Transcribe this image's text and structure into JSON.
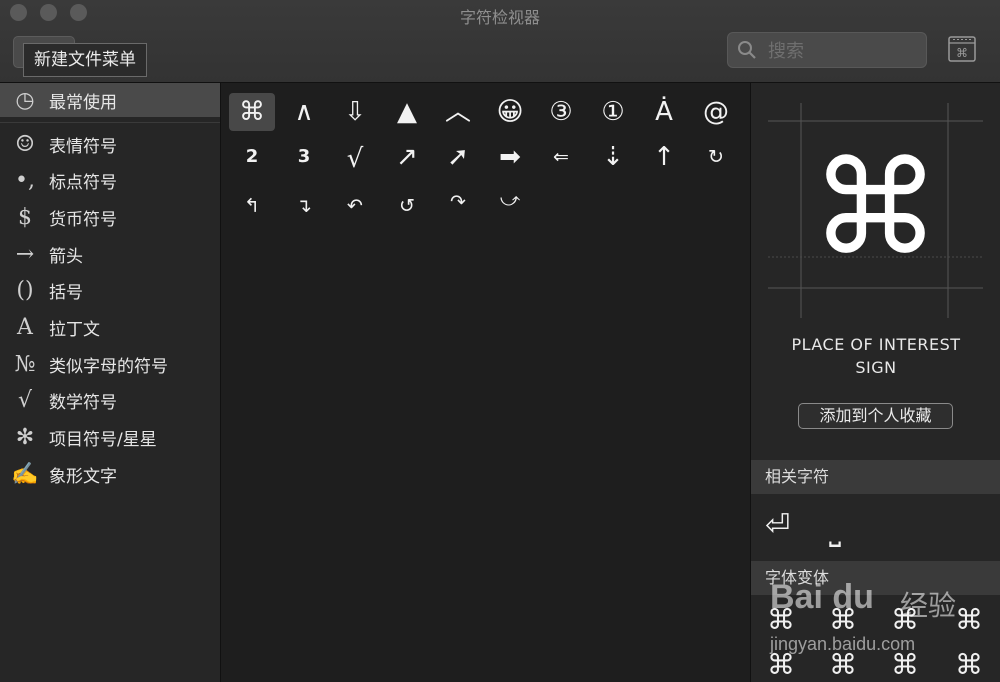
{
  "window": {
    "title": "字符检视器"
  },
  "toolbar": {
    "tooltip": "新建文件菜单",
    "search_placeholder": "搜索"
  },
  "sidebar": {
    "items": [
      {
        "icon": "◷",
        "label": "最常使用",
        "selected": true
      },
      {
        "icon": "☺",
        "label": "表情符号"
      },
      {
        "icon": "•,",
        "label": "标点符号"
      },
      {
        "icon": "$",
        "label": "货币符号"
      },
      {
        "icon": "→",
        "label": "箭头"
      },
      {
        "icon": "()",
        "label": "括号"
      },
      {
        "icon": "A",
        "label": "拉丁文"
      },
      {
        "icon": "№",
        "label": "类似字母的符号"
      },
      {
        "icon": "√",
        "label": "数学符号"
      },
      {
        "icon": "✻",
        "label": "项目符号/星星"
      },
      {
        "icon": "✍",
        "label": "象形文字"
      }
    ]
  },
  "grid": {
    "rows": [
      [
        "⌘",
        "∧",
        "⇩",
        "▲",
        "︿",
        "😀",
        "③",
        "①",
        "Ȧ",
        "@"
      ],
      [
        "2",
        "3",
        "√",
        "↗",
        "➚",
        "➡",
        "⇐",
        "⇣",
        "↑",
        "↻"
      ],
      [
        "↰",
        "↴",
        "↶",
        "↺",
        "↷",
        "⤻"
      ]
    ]
  },
  "detail": {
    "glyph": "⌘",
    "name_line1": "PLACE OF INTEREST",
    "name_line2": "SIGN",
    "fav_button": "添加到个人收藏",
    "related_header": "相关字符",
    "related": [
      "⏎",
      "⎵"
    ],
    "variants_header": "字体变体",
    "variants": [
      "⌘",
      "⌘",
      "⌘",
      "⌘",
      "⌘",
      "⌘",
      "⌘",
      "⌘"
    ]
  },
  "watermark": {
    "logo": "Bai du",
    "text": "经验",
    "url": "jingyan.baidu.com"
  }
}
